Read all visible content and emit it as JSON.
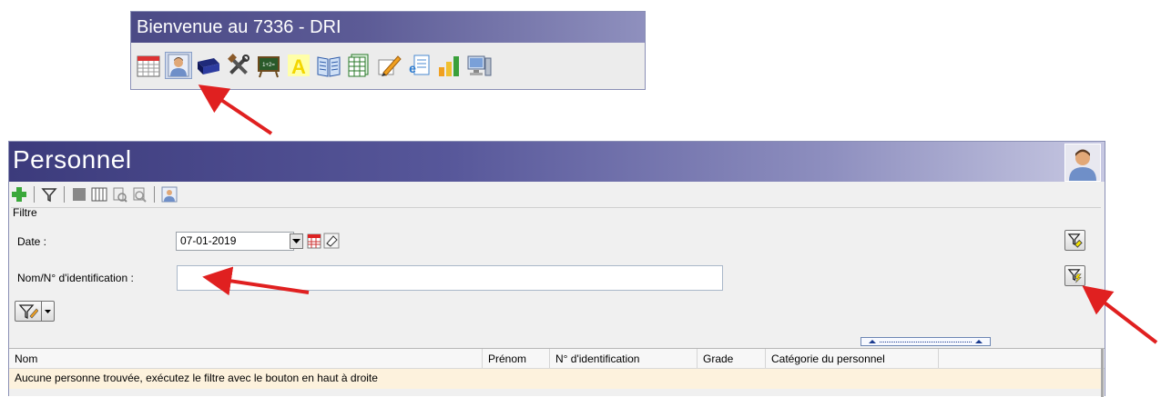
{
  "launcher": {
    "title": "Bienvenue au 7336 - DRI",
    "icons": [
      "calendar-icon",
      "personnel-icon",
      "classroom-icon",
      "tools-icon",
      "blackboard-icon",
      "letter-a-icon",
      "book-icon",
      "spreadsheet-icon",
      "pencil-icon",
      "e-document-icon",
      "bar-chart-icon",
      "computer-icon"
    ],
    "blackboard_text": "1+2="
  },
  "personnel": {
    "title": "Personnel",
    "toolbar_icons": [
      "add-icon",
      "filter-icon",
      "stop-icon",
      "columns-icon",
      "export-icon",
      "print-preview-icon",
      "person-icon"
    ],
    "filter": {
      "legend": "Filtre",
      "date_label": "Date :",
      "date_value": "07-01-2019",
      "name_label": "Nom/N° d'identification :",
      "name_value": ""
    },
    "grid": {
      "columns": [
        "Nom",
        "Prénom",
        "N° d'identification",
        "Grade",
        "Catégorie du personnel"
      ],
      "empty_message": "Aucune personne trouvée, exécutez le filtre avec le bouton en haut à droite"
    }
  },
  "colors": {
    "title_bar_dark": "#3c3b7c",
    "title_bar_light": "#c7c8e2",
    "row_highlight": "#fdf2dd",
    "annotation_arrow": "#e02020"
  }
}
